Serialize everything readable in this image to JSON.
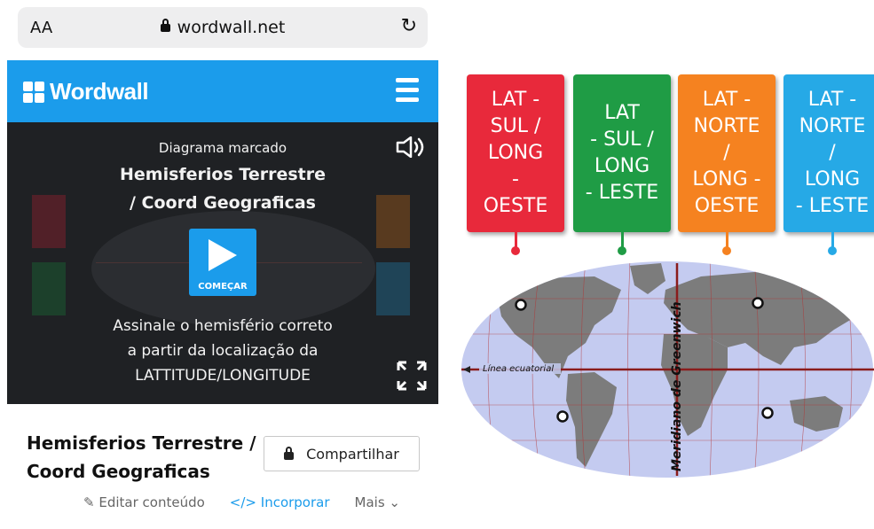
{
  "browser": {
    "aa_label": "AA",
    "url": "wordwall.net"
  },
  "wordwall": {
    "brand": "Wordwall"
  },
  "player": {
    "subtitle": "Diagrama marcado",
    "title_line1": "Hemisferios Terrestre",
    "title_line2": "/ Coord Geograficas",
    "play_label": "COMEÇAR",
    "instruction_line1": "Assinale o hemisfério correto",
    "instruction_line2": "a partir da localização da",
    "instruction_line3": "LATTITUDE/LONGITUDE"
  },
  "activity": {
    "title_line1": "Hemisferios Terrestre /",
    "title_line2": "Coord Geograficas",
    "share_label": "Compartilhar",
    "edit_label": "Editar conteúdo",
    "embed_label": "Incorporar",
    "more_label": "Mais"
  },
  "diagram": {
    "cards": [
      {
        "lines": [
          "LAT -",
          "SUL /",
          "LONG",
          "-",
          "OESTE"
        ],
        "color": "#e8293b"
      },
      {
        "lines": [
          "LAT",
          "- SUL /",
          "LONG",
          "- LESTE"
        ],
        "color": "#1f9c45"
      },
      {
        "lines": [
          "LAT -",
          "NORTE",
          "/",
          "LONG -",
          "OESTE"
        ],
        "color": "#f58220"
      },
      {
        "lines": [
          "LAT -",
          "NORTE",
          "/",
          "LONG",
          "- LESTE"
        ],
        "color": "#26a9e6"
      }
    ],
    "equator_label": "Línea ecuatorial",
    "meridian_label": "Meridiano de Greenwich"
  },
  "colors": {
    "brand_blue": "#1b9ceb",
    "player_bg": "#1f2124",
    "ocean": "#c4cbf0",
    "land": "#7c7c7c"
  }
}
